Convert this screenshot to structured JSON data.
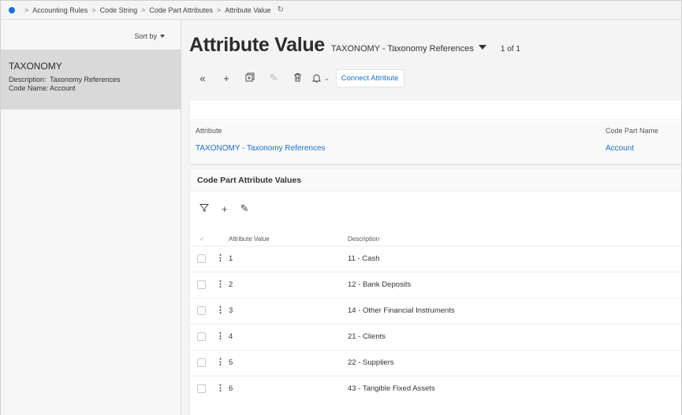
{
  "breadcrumb": {
    "items": [
      "Accounting Rules",
      "Code String",
      "Code Part Attributes",
      "Attribute Value"
    ],
    "separator": ">"
  },
  "left_panel": {
    "sort_label": "Sort by",
    "item": {
      "title": "TAXONOMY",
      "description_label": "Description:",
      "description_value": "Taxonomy References",
      "code_name_label": "Code Name:",
      "code_name_value": "Account"
    }
  },
  "header": {
    "title": "Attribute Value",
    "record_name": "TAXONOMY - Taxonomy References",
    "record_count": "1 of 1"
  },
  "toolbar": {
    "connect_label": "Connect Attribute"
  },
  "detail": {
    "attribute_label": "Attribute",
    "attribute_value": "TAXONOMY - Taxonomy References",
    "code_part_label": "Code Part Name",
    "code_part_value": "Account"
  },
  "values_card": {
    "title": "Code Part Attribute Values",
    "columns": [
      "Attribute Value",
      "Description"
    ],
    "rows": [
      {
        "value": "1",
        "description": "11 - Cash"
      },
      {
        "value": "2",
        "description": "12 - Bank Deposits"
      },
      {
        "value": "3",
        "description": "14 - Other Financial Instruments"
      },
      {
        "value": "4",
        "description": "21 - Clients"
      },
      {
        "value": "5",
        "description": "22 - Suppliers"
      },
      {
        "value": "6",
        "description": "43 - Tangible Fixed Assets"
      }
    ]
  },
  "colors": {
    "accent": "#1a6fd0",
    "selected_item": "#d9d9d9",
    "background": "#f4f4f4"
  }
}
